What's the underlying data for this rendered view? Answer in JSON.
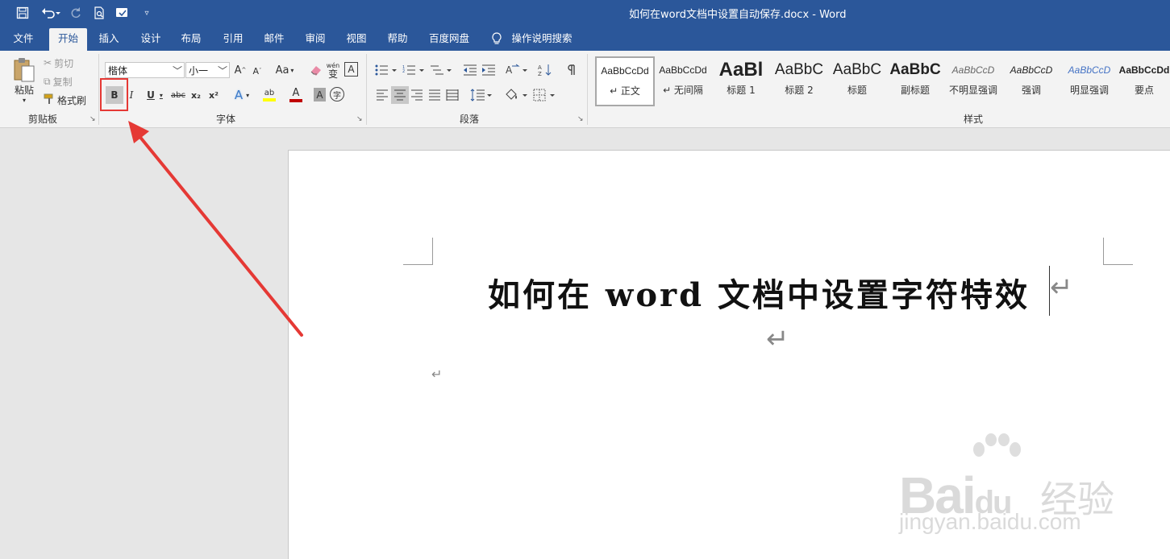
{
  "titlebar": {
    "title": "如何在word文档中设置自动保存.docx  -  Word",
    "bg_color": "#2b579a",
    "quick_access": [
      "save-icon",
      "undo-icon",
      "redo-icon",
      "print-preview-icon",
      "touch-mode-icon",
      "customize-dropdown-icon"
    ]
  },
  "tabs": [
    "文件",
    "开始",
    "插入",
    "设计",
    "布局",
    "引用",
    "邮件",
    "审阅",
    "视图",
    "帮助",
    "百度网盘",
    "操作说明搜索"
  ],
  "active_tab": "开始",
  "ribbon": {
    "clipboard": {
      "label": "剪贴板",
      "paste": "粘贴",
      "cut": "剪切",
      "copy": "复制",
      "format_painter": "格式刷"
    },
    "font": {
      "label": "字体",
      "font_name": "楷体",
      "font_size": "小一",
      "grow": "A",
      "shrink": "A",
      "change_case": "Aa",
      "phonetic": "wén",
      "phonetic_char": "变",
      "border_char": "A",
      "bold": "B",
      "italic": "I",
      "underline": "U",
      "strikethrough": "abc",
      "subscript": "x₂",
      "superscript": "x²",
      "text_effects": "A",
      "highlight": "ab",
      "font_color": "A",
      "char_shading": "A",
      "enclose": "字"
    },
    "paragraph": {
      "label": "段落"
    },
    "styles": {
      "label": "样式",
      "items": [
        {
          "preview": "AaBbCcDd",
          "name": "↵ 正文"
        },
        {
          "preview": "AaBbCcDd",
          "name": "↵ 无间隔"
        },
        {
          "preview": "AaBl",
          "name": "标题 1"
        },
        {
          "preview": "AaBbC",
          "name": "标题 2"
        },
        {
          "preview": "AaBbC",
          "name": "标题"
        },
        {
          "preview": "AaBbC",
          "name": "副标题"
        },
        {
          "preview": "AaBbCcD",
          "name": "不明显强调"
        },
        {
          "preview": "AaBbCcD",
          "name": "强调"
        },
        {
          "preview": "AaBbCcD",
          "name": "明显强调"
        },
        {
          "preview": "AaBbCcDd",
          "name": "要点"
        }
      ]
    }
  },
  "document": {
    "title_text": "如何在 word 文档中设置字符特效",
    "para_mark": "↵"
  },
  "annotation": {
    "color": "#e53935"
  },
  "watermark": {
    "brand": "Bai",
    "brand2": "du",
    "cn": "经验",
    "url": "jingyan.baidu.com"
  }
}
